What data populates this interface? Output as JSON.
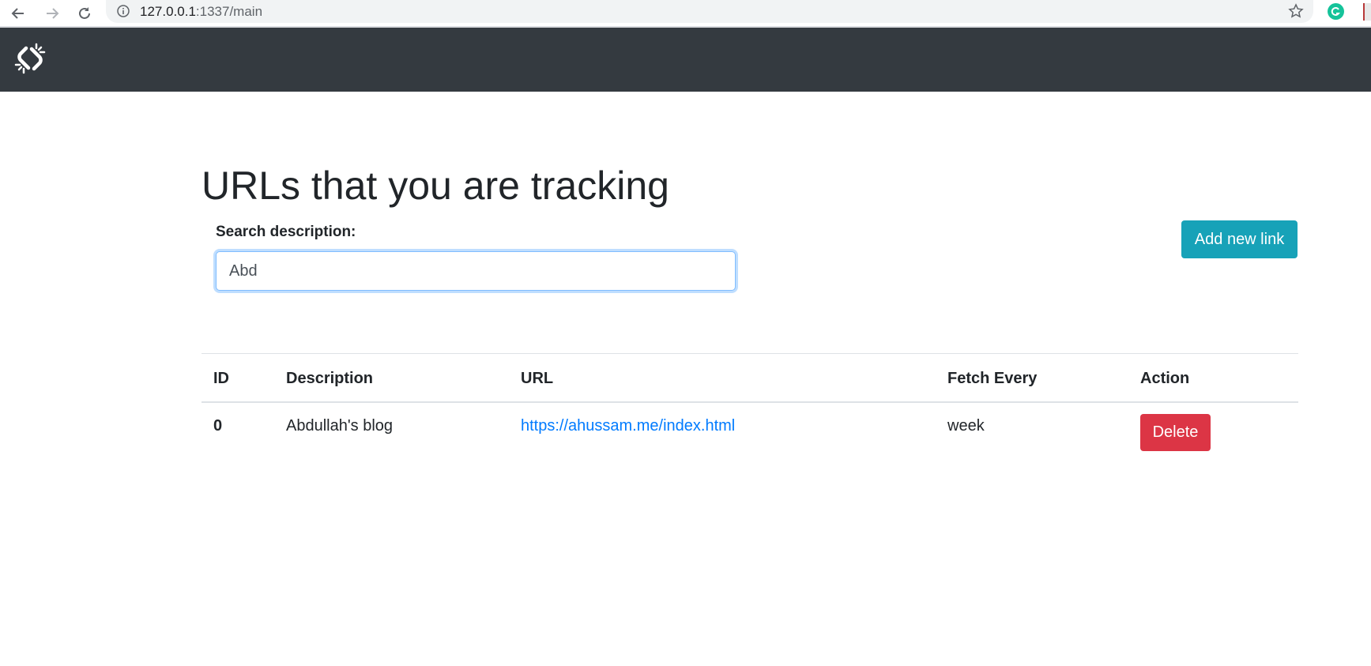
{
  "browser": {
    "url_host": "127.0.0.1",
    "url_rest": ":1337/main",
    "icons": [
      "back-icon",
      "forward-icon",
      "reload-icon",
      "info-icon",
      "star-icon",
      "grammarly-icon",
      "pdf-extension-icon"
    ]
  },
  "navbar": {
    "logo_icon": "broken-link-icon",
    "background": "#343a40"
  },
  "main": {
    "title": "URLs that you are tracking",
    "search": {
      "label": "Search description:",
      "value": "Abd"
    },
    "add_button_label": "Add new link",
    "table": {
      "columns": [
        "ID",
        "Description",
        "URL",
        "Fetch Every",
        "Action"
      ],
      "rows": [
        {
          "id": "0",
          "description": "Abdullah's blog",
          "url": "https://ahussam.me/index.html",
          "fetch_every": "week",
          "action_label": "Delete"
        }
      ]
    }
  },
  "colors": {
    "info_button": "#17a2b8",
    "danger_button": "#dc3545",
    "link": "#007bff"
  }
}
